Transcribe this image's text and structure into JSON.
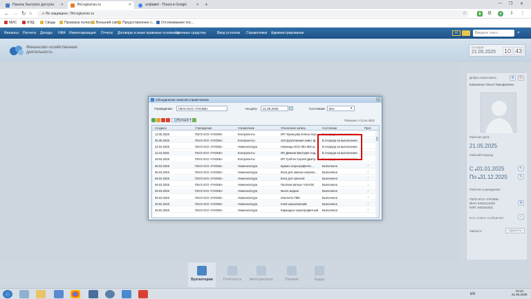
{
  "browser": {
    "tabs": [
      {
        "label": "Панель быстрого доступа",
        "active": false
      },
      {
        "label": "fhd.egisznso.ru",
        "active": true
      },
      {
        "label": "алфавит - Поиск в Google",
        "active": false
      }
    ],
    "new_tab": "+",
    "address": {
      "security": "Не защищено",
      "url": "fhd.egisznso.ru"
    },
    "bookmarks": [
      "МИС",
      "ФЭД",
      "Своды",
      "Проверка полиса",
      "Внешний сайт",
      "Предоставление с...",
      "Отслеживание пос..."
    ]
  },
  "menu": {
    "items": [
      "Финансы",
      "Расчеты",
      "Доходы",
      "НФА",
      "Инвентаризация",
      "Отчеты",
      "Договоры и иные правовые основания",
      "Целевые средства",
      "Ввод остатков",
      "Справочники",
      "Администрирование"
    ],
    "search_placeholder": "Введите текст..."
  },
  "header": {
    "logo_text": "Финансово-хозяйственная деятельность",
    "date_label": "Сегодня:",
    "date": "21.05.2025",
    "time_h": "10",
    "time_m": "43"
  },
  "right_panel": {
    "welcome": "Добро пожаловать",
    "user_name": "Коваленко Ольга Тимофеевна",
    "workday_label": "Рабочая дата:",
    "workday": "21.05.2025",
    "period_label": "Рабочий период:",
    "period_from_prefix": "С",
    "period_from": "01.01.2025",
    "period_to_prefix": "По",
    "period_to": "31.12.2025",
    "org_label": "Рабочее учреждение:",
    "org_lines": [
      "ГБУЗ НСО «ГНОКБ»",
      "ИНН: 5402114230",
      "КПП: 540201001"
    ],
    "messages": "Есть новые сообщения:",
    "close_label": "Закрыто:",
    "delete_btn": "УДАЛИТЬ"
  },
  "dialog": {
    "title": "Объединение записей справочников",
    "org_label": "Учреждение:",
    "org_value": "ГБУЗ НСО «ГНОКБ»",
    "date_label": "На дату:",
    "date_value": "21.05.2025",
    "state_label": "Состояние:",
    "state_value": "Все",
    "functions_label": "Функции",
    "shown": "Показано 1-13 из 4522",
    "columns": [
      "Создано",
      "Учреждение",
      "Справочник",
      "Эталонная запись",
      "Состояние",
      "Прот."
    ],
    "rows": [
      [
        "12.05.2025",
        "ГБУЗ НСО «ГНОКБ»",
        "Контрагенты",
        "ИП Чернецова Елена Серг...",
        "В очереди на выполнение"
      ],
      [
        "06.05.2025",
        "ГБУЗ НСО «ГНОКБ»",
        "Контрагенты",
        "Золтруаситвание ковес ф...",
        "В очереди на выполнение"
      ],
      [
        "22.04.2025",
        "ГБУЗ НСО «ГНОКБ»",
        "Номенклатура",
        "Ножницы ЕСО 801-800 м...",
        "В очереди на выполнение"
      ],
      [
        "11.04.2025",
        "ГБУЗ НСО «ГНОКБ»",
        "Контрагенты",
        "ИП Дёмина Виктория Анд...",
        "В очереди на выполнение"
      ],
      [
        "28.03.2025",
        "ГБУЗ НСО «ГНОКБ»",
        "Контрагенты",
        "ИП Тузбтек Сергей Дмитр...",
        "В очереди на выполнение"
      ],
      [
        "06.03.2025",
        "ГБУЗ НСО «ГНОКБ»",
        "Номенклатура",
        "Бумага ксерографичес...",
        "Выполнено"
      ],
      [
        "06.03.2025",
        "ГБУЗ НСО «ГНОКБ»",
        "Номенклатура",
        "Блок для записи непрокл...",
        "Выполнено"
      ],
      [
        "06.03.2025",
        "ГБУЗ НСО «ГНОКБ»",
        "Номенклатура",
        "Блок для записей",
        "Выполнено"
      ],
      [
        "06.03.2025",
        "ГБУЗ НСО «ГНОКБ»",
        "Номенклатура",
        "Палочки ватные VISAGE",
        "Выполнено"
      ],
      [
        "06.03.2025",
        "ГБУЗ НСО «ГНОКБ»",
        "Номенклатура",
        "Мыло жидкое",
        "Выполнено"
      ],
      [
        "06.03.2025",
        "ГБУЗ НСО «ГНОКБ»",
        "Номенклатура",
        "Изолента ПВХ",
        "Выполнено"
      ],
      [
        "28.02.2025",
        "ГБУЗ НСО «ГНОКБ»",
        "Номенклатура",
        "Клей канцелярский",
        "Выполнено"
      ],
      [
        "28.02.2025",
        "ГБУЗ НСО «ГНОКБ»",
        "Номенклатура",
        "Карандаш чернографитный",
        "Выполнено"
      ]
    ]
  },
  "dock": {
    "items": [
      "Бухгалтерия",
      "Отчетность",
      "Автотранспорт",
      "Питание",
      "Кадры"
    ]
  },
  "taskbar": {
    "lang": "EN",
    "time": "10:44",
    "date": "21.05.2025"
  }
}
